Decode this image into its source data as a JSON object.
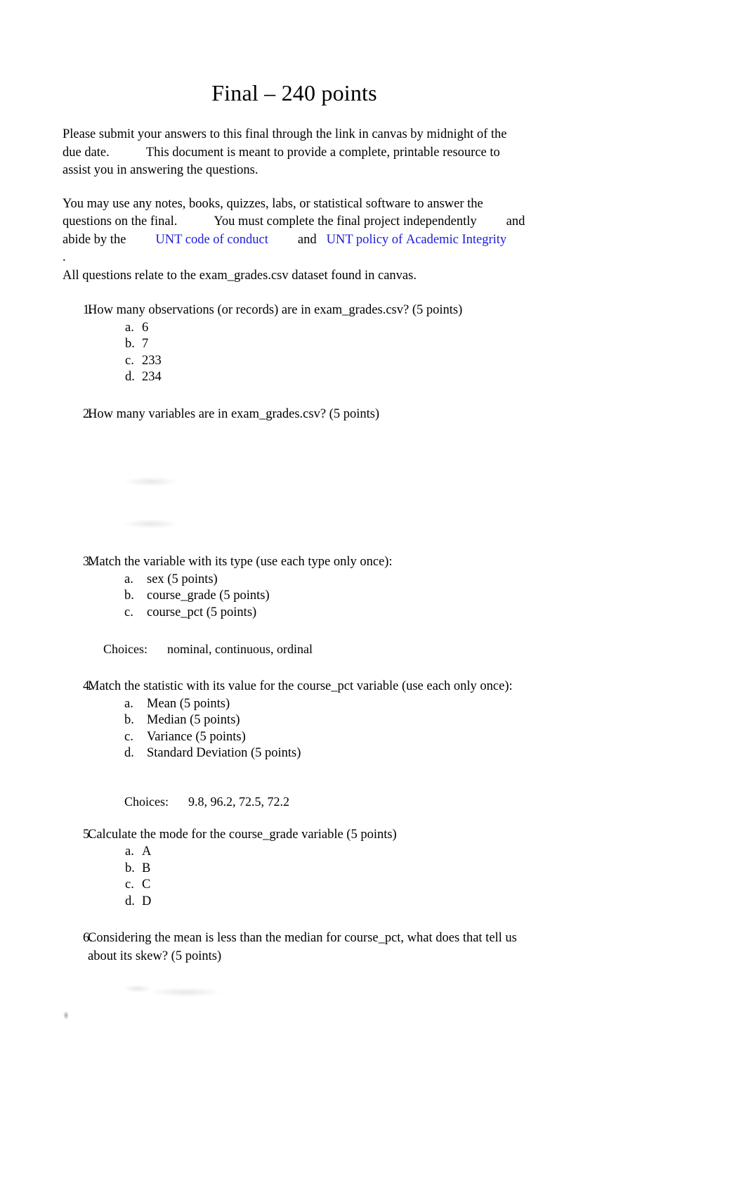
{
  "document": {
    "title": "Final – 240 points",
    "intro_paragraph": {
      "line1": "Please submit your answers to this final through the link in canvas by midnight",
      "line2a": "of the due date.",
      "line2b": "This document is meant to provide a complete, printable",
      "line3": "resource to assist you in answering the questions."
    },
    "policy_paragraph": {
      "line1": "You may use any notes, books, quizzes, labs, or statistical software to answer",
      "line2a": "the questions on the final.",
      "line2b": "You must complete the final project",
      "line3a": "independently",
      "line3b": "and abide by the",
      "link1": "UNT code of conduct",
      "conjunction": "and",
      "link2_part1": "UNT policy of",
      "link2_part2": "Academic Integrity",
      "period": "."
    },
    "dataset_note": "All questions relate to the exam_grades.csv dataset found in canvas.",
    "link_color": "#1b1bdd"
  },
  "questions": [
    {
      "number": "1.",
      "text": "How many observations (or records) are in exam_grades.csv? (5 points)",
      "options": [
        {
          "letter": "a.",
          "text": "6"
        },
        {
          "letter": "b.",
          "text": "7"
        },
        {
          "letter": "c.",
          "text": "233"
        },
        {
          "letter": "d.",
          "text": "234"
        }
      ]
    },
    {
      "number": "2.",
      "text": "How many variables are in exam_grades.csv? (5 points)",
      "options": []
    },
    {
      "number": "3.",
      "text": "Match the variable with its type (use each type only once):",
      "options": [
        {
          "letter": "a.",
          "text": "sex (5 points)"
        },
        {
          "letter": "b.",
          "text": "course_grade (5 points)"
        },
        {
          "letter": "c.",
          "text": "course_pct (5 points)"
        }
      ],
      "choices_label": "Choices:",
      "choices_values": "nominal, continuous, ordinal"
    },
    {
      "number": "4.",
      "text_line1": "Match the statistic with its value for the course_pct variable (use each",
      "text_line2": "only once):",
      "options": [
        {
          "letter": "a.",
          "text": "Mean (5 points)"
        },
        {
          "letter": "b.",
          "text": "Median (5 points)"
        },
        {
          "letter": "c.",
          "text": "Variance (5 points)"
        },
        {
          "letter": "d.",
          "text": "Standard Deviation (5 points)"
        }
      ],
      "choices_label": "Choices:",
      "choices_values": "9.8, 96.2, 72.5, 72.2"
    },
    {
      "number": "5.",
      "text": "Calculate the mode for the course_grade variable (5 points)",
      "options": [
        {
          "letter": "a.",
          "text": "A"
        },
        {
          "letter": "b.",
          "text": "B"
        },
        {
          "letter": "c.",
          "text": "C"
        },
        {
          "letter": "d.",
          "text": "D"
        }
      ]
    },
    {
      "number": "6.",
      "text_line1": "Considering the mean is less than the median for course_pct, what does",
      "text_line2": "that tell us about its skew? (5 points)",
      "options": []
    }
  ]
}
